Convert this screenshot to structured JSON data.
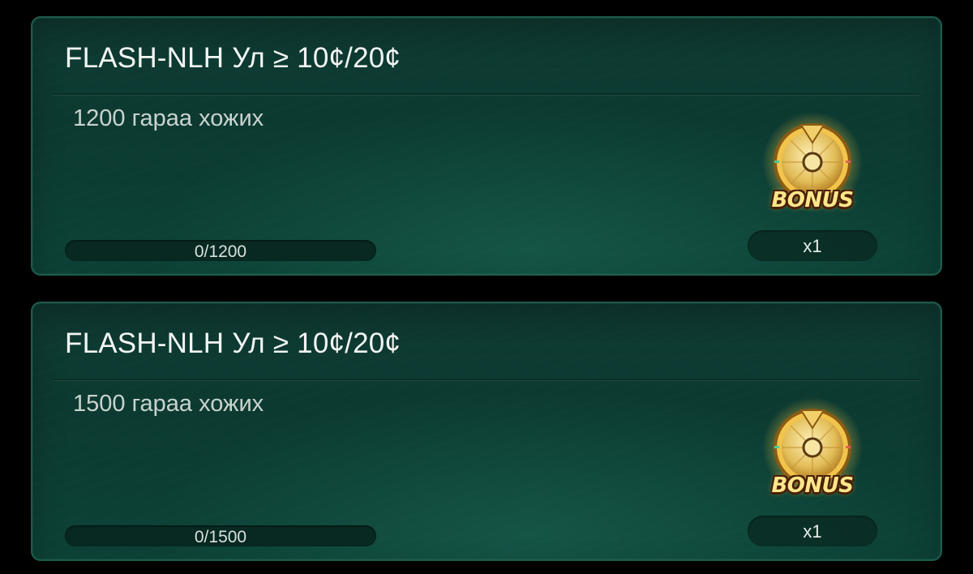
{
  "tasks": [
    {
      "title": "FLASH-NLH Ул ≥ 10¢/20¢",
      "description": "1200 гараа хожих",
      "progress": {
        "current": 0,
        "target": 1200,
        "label": "0/1200"
      },
      "reward": {
        "label": "BONUS",
        "count": "x1",
        "icon": "bonus-wheel-icon"
      }
    },
    {
      "title": "FLASH-NLH Ул ≥ 10¢/20¢",
      "description": "1500 гараа хожих",
      "progress": {
        "current": 0,
        "target": 1500,
        "label": "0/1500"
      },
      "reward": {
        "label": "BONUS",
        "count": "x1",
        "icon": "bonus-wheel-icon"
      }
    }
  ],
  "colors": {
    "card_background": "#0c3a31",
    "card_border": "#1d5b4d",
    "title_text": "#f2f5f3",
    "description_text": "#c9d3cf",
    "progress_track": "#082822",
    "bonus_gold": "#e7b93a"
  }
}
